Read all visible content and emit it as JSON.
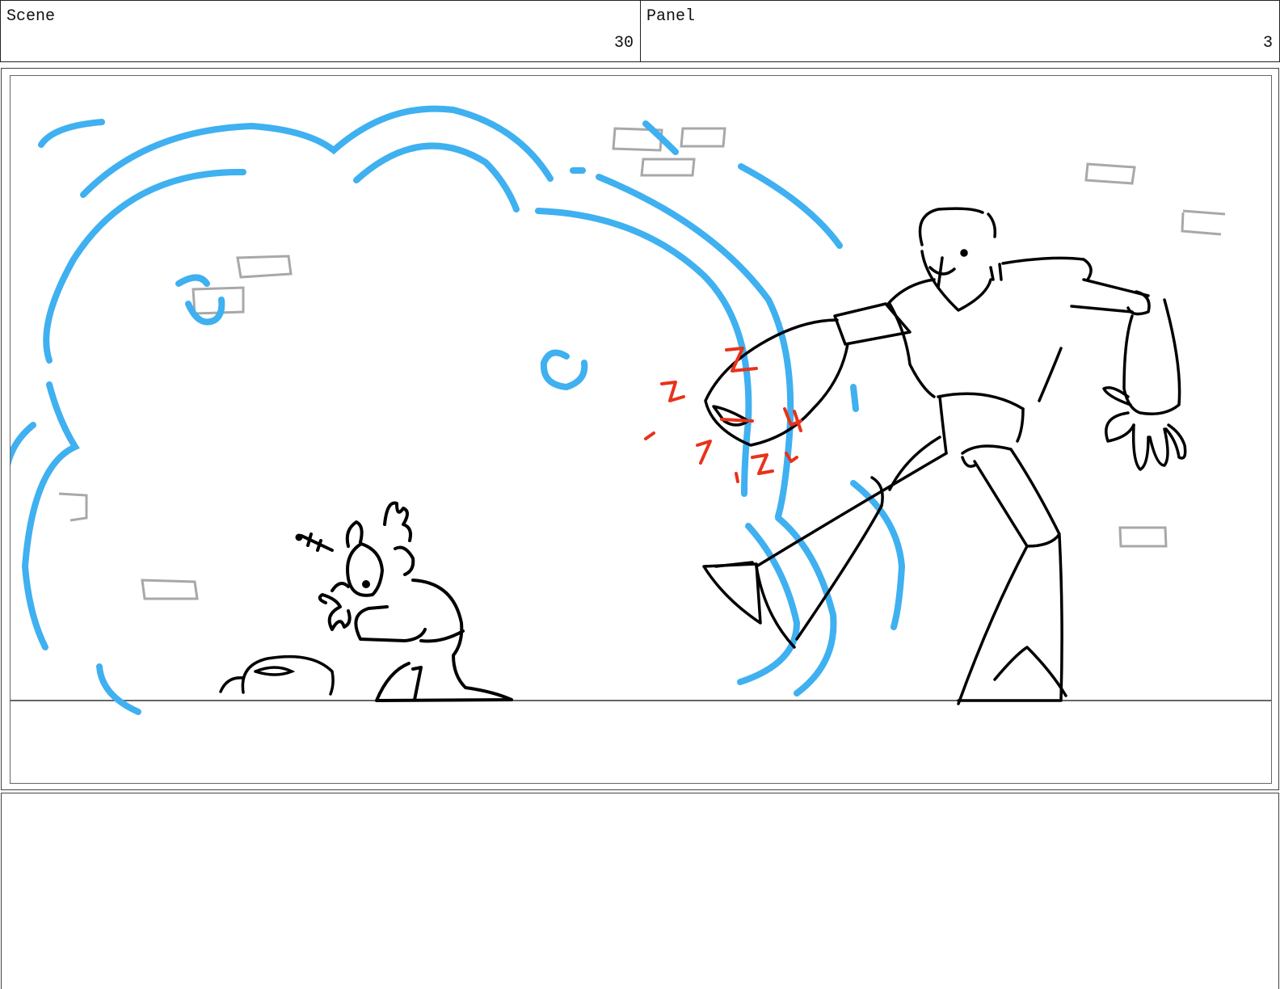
{
  "header": {
    "scene_label": "Scene",
    "scene_number": "30",
    "panel_label": "Panel",
    "panel_number": "3"
  },
  "notes": {
    "text": ""
  },
  "colors": {
    "smoke": "#3fb0f0",
    "ink": "#000000",
    "bricks": "#a8a8a8",
    "impact": "#e8321a",
    "frame_border": "#444444"
  }
}
